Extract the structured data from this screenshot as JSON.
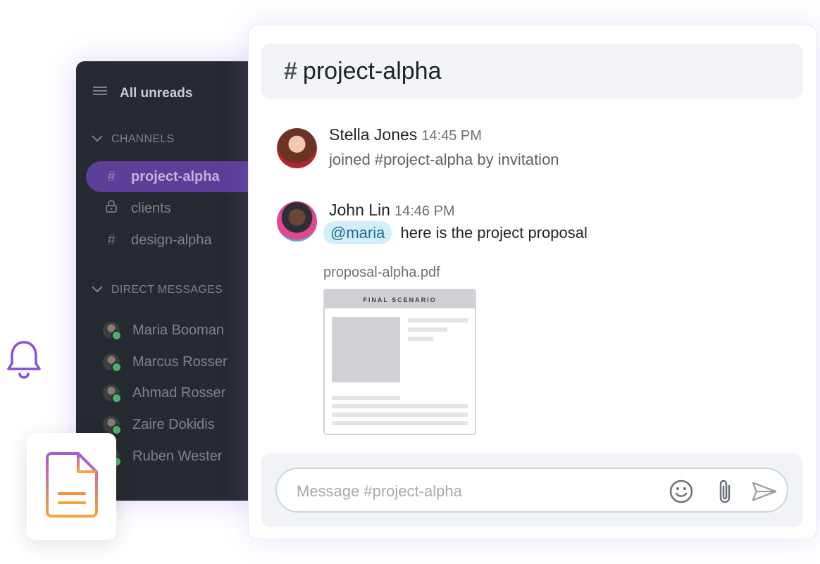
{
  "sidebar": {
    "all_unreads": "All unreads",
    "channels_heading": "CHANNELS",
    "channels": [
      {
        "symbol": "#",
        "label": "project-alpha",
        "active": true
      },
      {
        "symbol": "lock",
        "label": "clients",
        "active": false
      },
      {
        "symbol": "#",
        "label": "design-alpha",
        "active": false
      }
    ],
    "dm_heading": "DIRECT MESSAGES",
    "direct_messages": [
      {
        "label": "Maria Booman",
        "status": "online"
      },
      {
        "label": "Marcus Rosser",
        "status": "online"
      },
      {
        "label": "Ahmad Rosser",
        "status": "online"
      },
      {
        "label": "Zaire Dokidis",
        "status": "online"
      },
      {
        "label": "Ruben Wester",
        "status": "online"
      }
    ]
  },
  "header": {
    "hash": "#",
    "channel": "project-alpha"
  },
  "messages": [
    {
      "author": "Stella Jones",
      "time": "14:45 PM",
      "text": "joined #project-alpha by invitation"
    },
    {
      "author": "John Lin",
      "time": "14:46 PM",
      "mention": "@maria",
      "text": "here is the project proposal"
    }
  ],
  "attachment": {
    "file_name": "proposal-alpha.pdf",
    "preview_heading": "FINAL SCENARIO"
  },
  "composer": {
    "placeholder": "Message #project-alpha"
  },
  "colors": {
    "accent": "#5b3f99",
    "online": "#4db06a",
    "sidebar_bg": "#262b31",
    "mention_bg": "#d3eefa"
  }
}
